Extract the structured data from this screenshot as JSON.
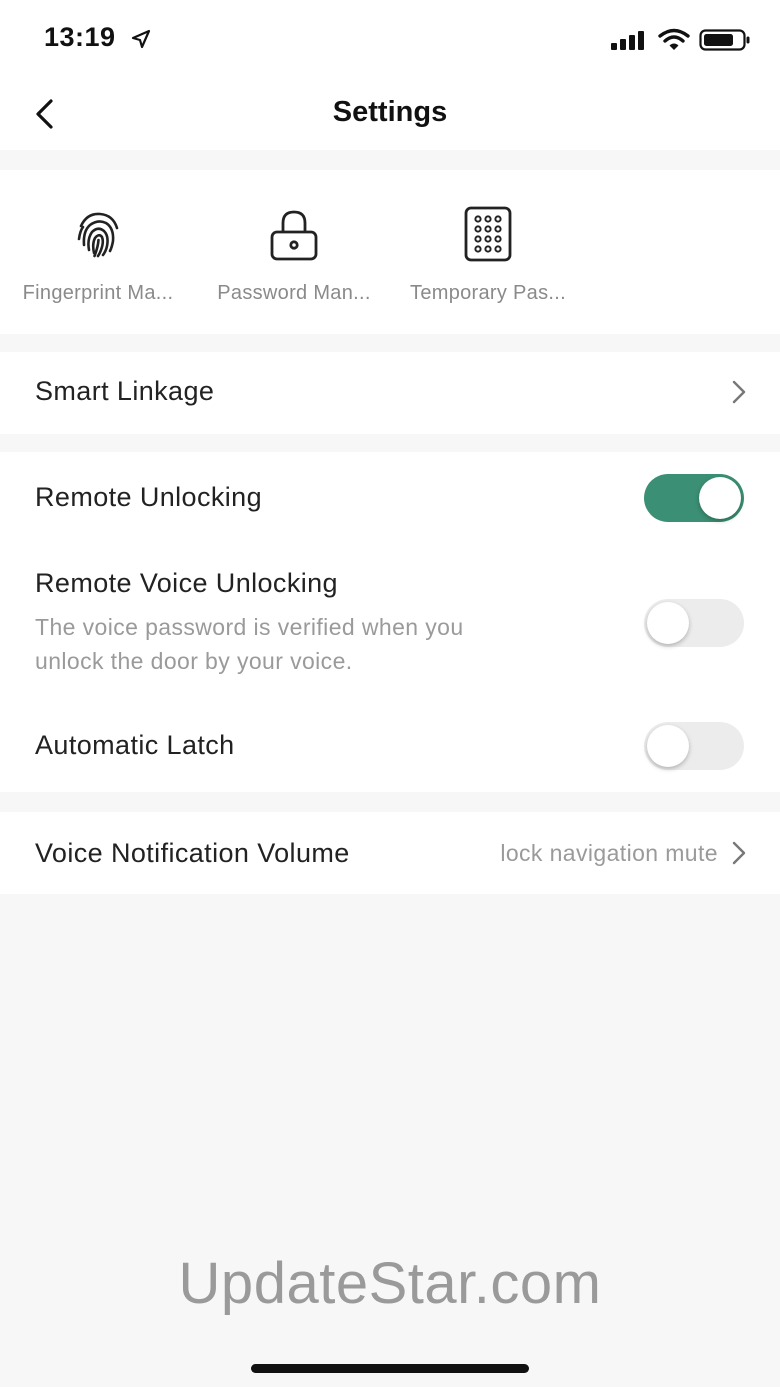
{
  "status_bar": {
    "time": "13:19"
  },
  "header": {
    "title": "Settings"
  },
  "quick_actions": [
    {
      "label": "Fingerprint Ma...",
      "icon": "fingerprint-icon"
    },
    {
      "label": "Password Man...",
      "icon": "lock-icon"
    },
    {
      "label": "Temporary Pas...",
      "icon": "keypad-icon"
    }
  ],
  "smart_linkage": {
    "label": "Smart Linkage"
  },
  "toggles": {
    "remote_unlocking": {
      "label": "Remote Unlocking",
      "on": true
    },
    "remote_voice_unlocking": {
      "label": "Remote Voice Unlocking",
      "description_line1": "The voice password is verified when you",
      "description_line2": "unlock the door by your voice.",
      "on": false
    },
    "automatic_latch": {
      "label": "Automatic Latch",
      "on": false
    }
  },
  "voice_volume": {
    "label": "Voice Notification Volume",
    "value": "lock navigation mute"
  },
  "watermark": "UpdateStar.com",
  "colors": {
    "accent": "#3b8f74",
    "background": "#f7f7f7",
    "muted_text": "#9a9a9a"
  }
}
